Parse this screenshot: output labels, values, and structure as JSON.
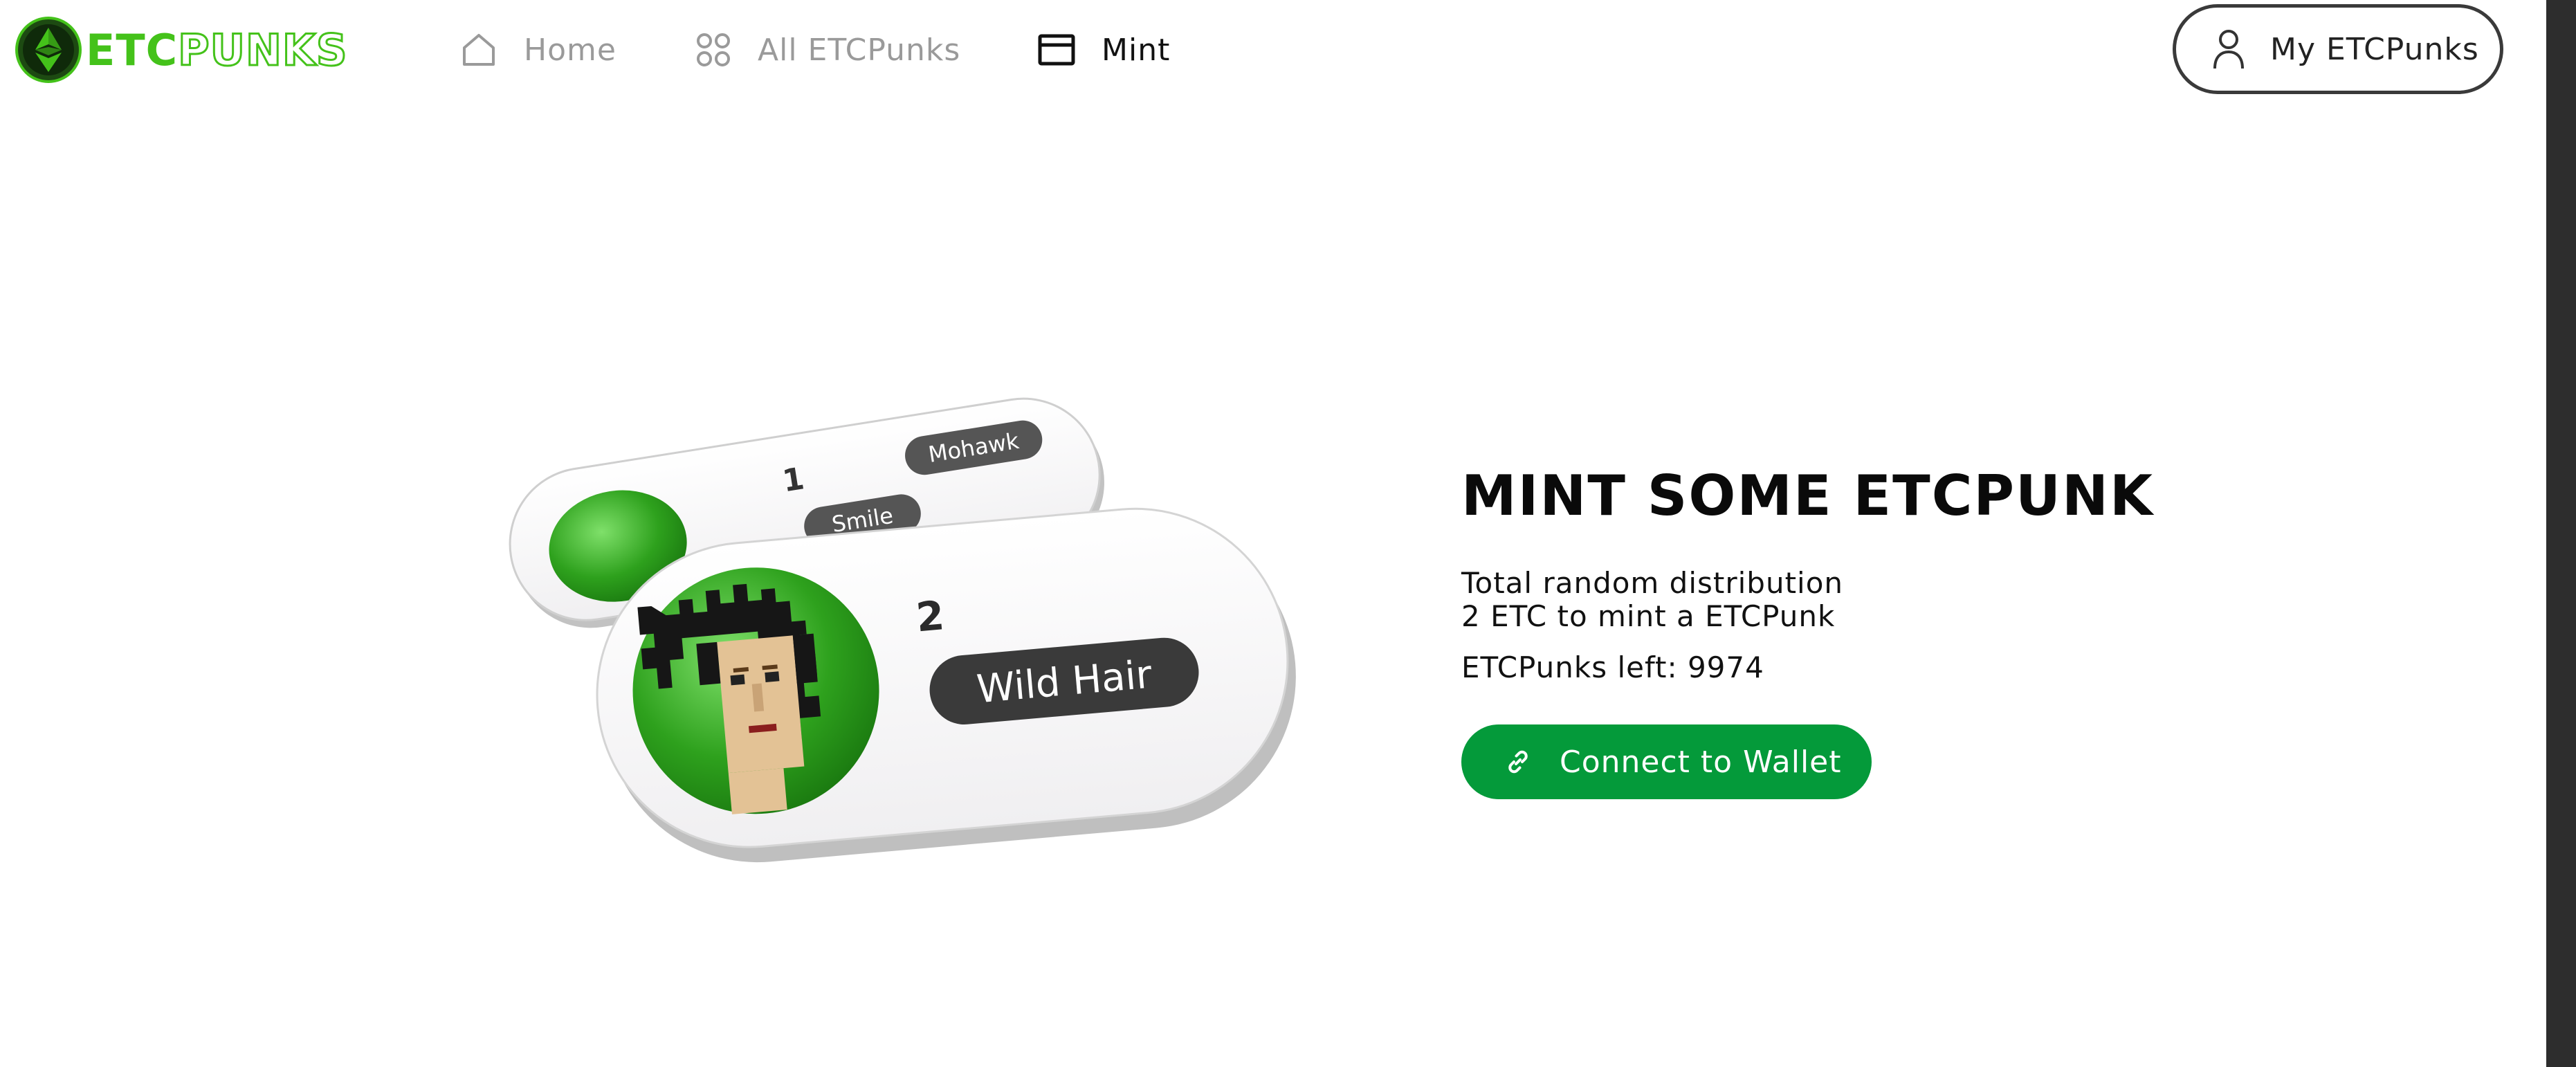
{
  "logo": {
    "text_etc": "ETC",
    "text_punks": "PUNKS",
    "icon": "ethereum-classic-icon"
  },
  "nav": {
    "items": [
      {
        "label": "Home",
        "icon": "home-icon",
        "active": false
      },
      {
        "label": "All ETCPunks",
        "icon": "grid-icon",
        "active": false
      },
      {
        "label": "Mint",
        "icon": "card-icon",
        "active": true
      }
    ]
  },
  "account_button": {
    "label": "My ETCPunks",
    "icon": "user-icon"
  },
  "hero": {
    "card_back": {
      "number": "1",
      "tags": [
        "Mohawk",
        "Smile"
      ]
    },
    "card_front": {
      "number": "2",
      "tag": "Wild Hair"
    }
  },
  "mint": {
    "title": "MINT SOME ETCPUNK",
    "line1": "Total random distribution",
    "line2": "2 ETC to mint a ETCPunk",
    "left_label": "ETCPunks left: 9974",
    "connect_label": "Connect to Wallet",
    "connect_icon": "link-icon"
  },
  "colors": {
    "accent": "#049a3a",
    "logo_green": "#44c21a",
    "inactive_nav": "#9a9a9a",
    "scroll_strip": "#2d2d2d"
  }
}
